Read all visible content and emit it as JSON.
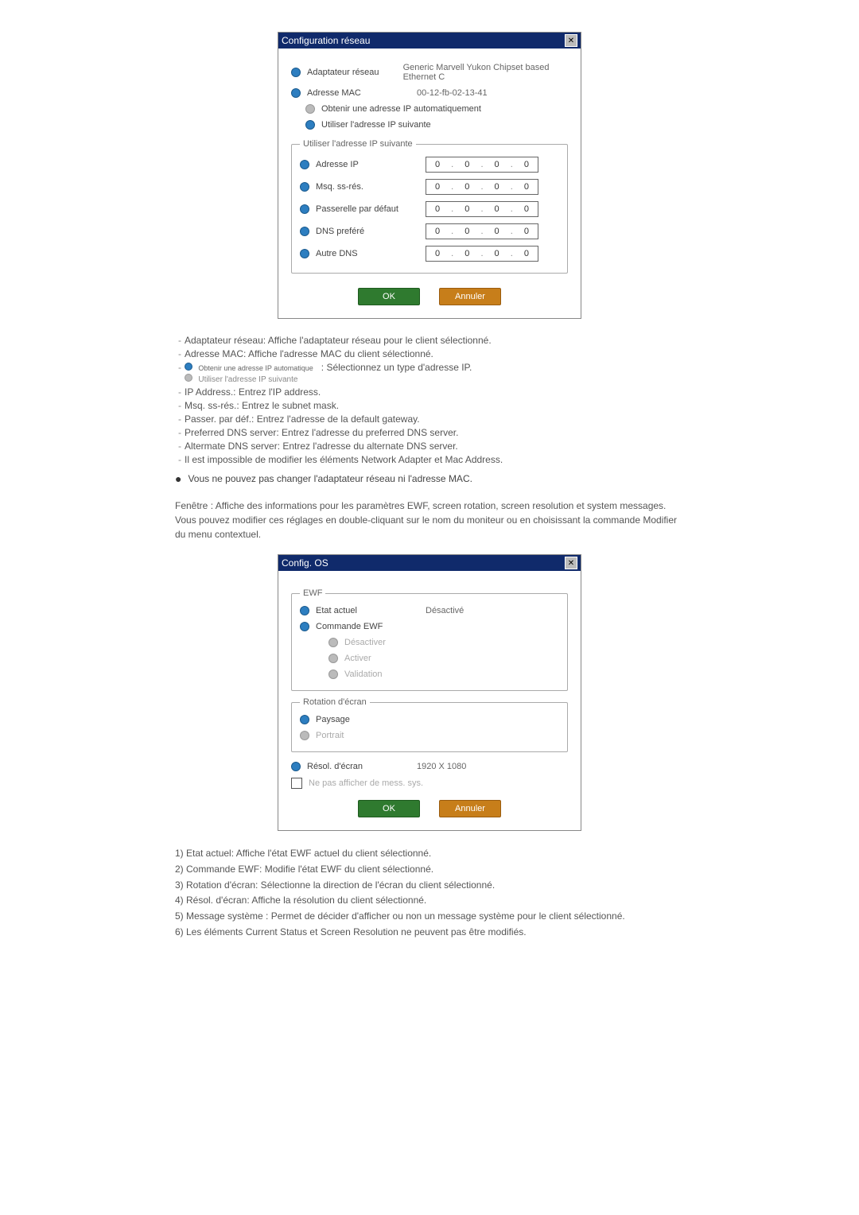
{
  "dialog1": {
    "title": "Configuration réseau",
    "adapter_label": "Adaptateur réseau",
    "adapter_value": "Generic Marvell Yukon Chipset based Ethernet C",
    "mac_label": "Adresse MAC",
    "mac_value": "00-12-fb-02-13-41",
    "opt_auto": "Obtenir une adresse IP automatiquement",
    "opt_static": "Utiliser l'adresse IP suivante",
    "fieldset_legend": "Utiliser l'adresse IP suivante",
    "ip_label": "Adresse IP",
    "mask_label": "Msq. ss-rés.",
    "gw_label": "Passerelle par défaut",
    "dns1_label": "DNS preféré",
    "dns2_label": "Autre DNS",
    "ip_value": [
      "0",
      "0",
      "0",
      "0"
    ],
    "ok": "OK",
    "cancel": "Annuler"
  },
  "desc_list": {
    "a": "Adaptateur réseau: Affiche l'adaptateur réseau pour le client sélectionné.",
    "b": "Adresse MAC: Affiche l'adresse MAC du client sélectionné.",
    "c_radio1": "Obtenir une adresse IP automatique",
    "c_radio2": "Utiliser l'adresse IP suivante",
    "c_tail": ": Sélectionnez un type d'adresse IP.",
    "d": "IP Address.: Entrez l'IP address.",
    "e": "Msq. ss-rés.: Entrez le subnet mask.",
    "f": "Passer. par déf.: Entrez l'adresse de la default gateway.",
    "g": "Preferred DNS server: Entrez l'adresse du preferred DNS server.",
    "h": "Altermate DNS server: Entrez l'adresse du alternate DNS server.",
    "i": "Il est impossible de modifier les éléments Network Adapter et Mac Address."
  },
  "note1": "Vous ne pouvez pas changer l'adaptateur réseau ni l'adresse MAC.",
  "para": "Fenêtre : Affiche des informations pour les paramètres EWF, screen rotation, screen resolution et system messages. Vous pouvez modifier ces réglages en double-cliquant sur le nom du moniteur ou en choisissant la commande Modifier du menu contextuel.",
  "dialog2": {
    "title": "Config. OS",
    "group_ewf": "EWF",
    "cur_label": "Etat actuel",
    "cur_value": "Désactivé",
    "cmd_label": "Commande EWF",
    "cmd_disable": "Désactiver",
    "cmd_enable": "Activer",
    "cmd_commit": "Validation",
    "group_rotation": "Rotation d'écran",
    "rot_landscape": "Paysage",
    "rot_portrait": "Portrait",
    "res_label": "Résol. d'écran",
    "res_value": "1920 X 1080",
    "nomsg": "Ne pas afficher de mess. sys.",
    "ok": "OK",
    "cancel": "Annuler"
  },
  "numlist": {
    "n1": "1) Etat actuel: Affiche l'état EWF actuel du client sélectionné.",
    "n2": "2) Commande EWF: Modifie l'état EWF du client sélectionné.",
    "n3": "3) Rotation d'écran: Sélectionne la direction de l'écran du client sélectionné.",
    "n4": "4) Résol. d'écran: Affiche la résolution du client sélectionné.",
    "n5": "5) Message système : Permet de décider d'afficher ou non un message système pour le client sélectionné.",
    "n6": "6) Les éléments Current Status et Screen Resolution ne peuvent pas être modifiés."
  }
}
